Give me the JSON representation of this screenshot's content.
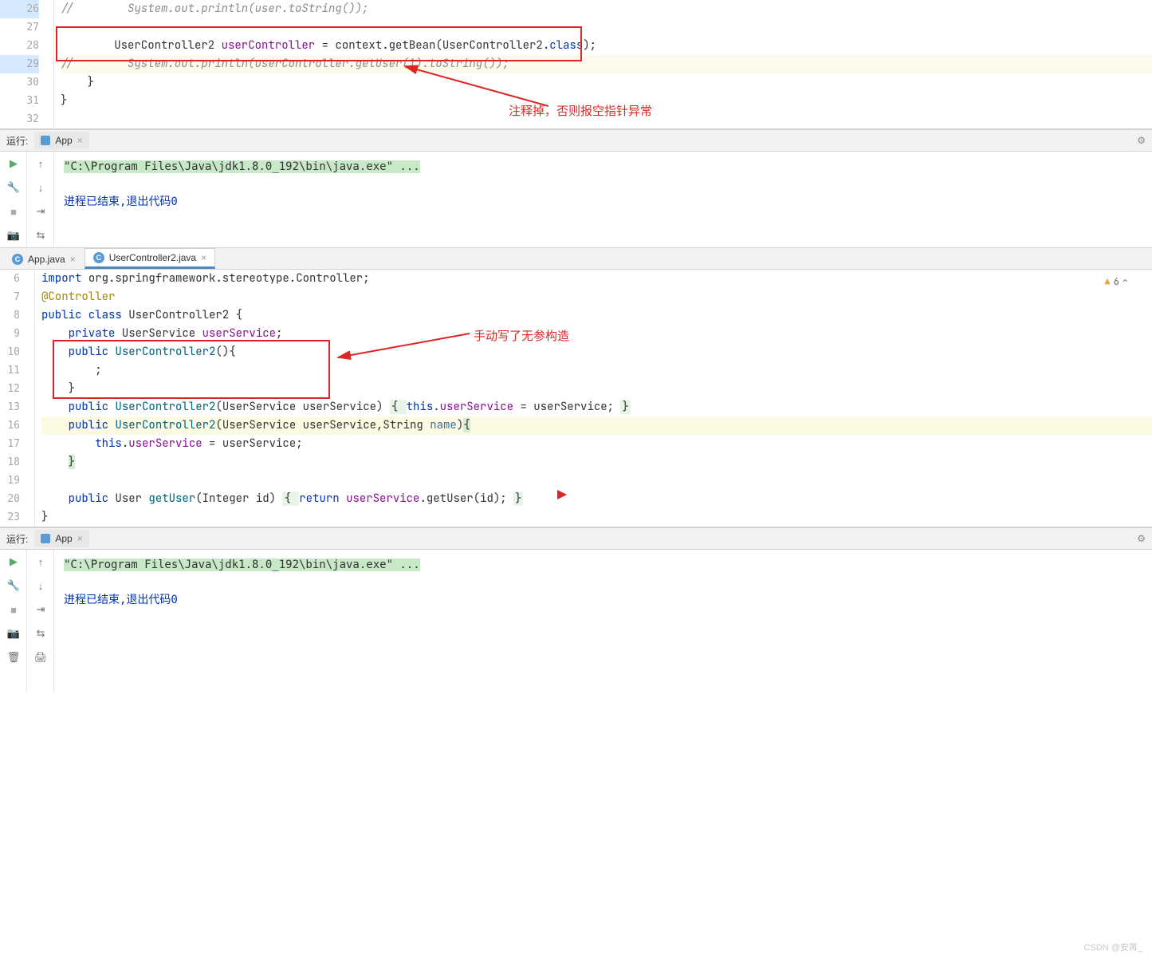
{
  "top_editor": {
    "lines": [
      {
        "n": "26",
        "cls": "changed",
        "html": "//        System.out.println(user.toString());",
        "comment": true
      },
      {
        "n": "27",
        "cls": "",
        "html": ""
      },
      {
        "n": "28",
        "cls": "",
        "tokens": [
          [
            "        UserController2 ",
            ""
          ],
          [
            "userController",
            "c-field"
          ],
          [
            " = context.getBean(UserController2.",
            ""
          ],
          [
            "class",
            "c-key"
          ],
          [
            ");",
            ""
          ]
        ]
      },
      {
        "n": "29",
        "cls": "changed",
        "hl": true,
        "tokens": [
          [
            "//        System.out.println(userController.getUser(1).toString());",
            "c-comment"
          ]
        ]
      },
      {
        "n": "30",
        "cls": "",
        "html": "    }"
      },
      {
        "n": "31",
        "cls": "",
        "html": "}"
      },
      {
        "n": "32",
        "cls": "",
        "html": ""
      }
    ],
    "annotation": "注释掉，否则报空指针异常"
  },
  "run_panels": {
    "label": "运行:",
    "app_tab": "App",
    "output_cmd": "\"C:\\Program Files\\Java\\jdk1.8.0_192\\bin\\java.exe\" ...",
    "output_exit": "进程已结束,退出代码0"
  },
  "file_tabs": [
    {
      "name": "App.java",
      "active": false
    },
    {
      "name": "UserController2.java",
      "active": true
    }
  ],
  "second_editor": {
    "warn_count": "6",
    "annotation": "手动写了无参构造",
    "lines": [
      {
        "n": "6",
        "tokens": [
          [
            "import ",
            "c-key"
          ],
          [
            "org.springframework.stereotype.Controller;",
            ""
          ]
        ]
      },
      {
        "n": "7",
        "tokens": [
          [
            "@Controller",
            "c-anno"
          ]
        ]
      },
      {
        "n": "8",
        "tokens": [
          [
            "public class ",
            "c-key"
          ],
          [
            "UserController2 {",
            ""
          ]
        ]
      },
      {
        "n": "9",
        "tokens": [
          [
            "    ",
            ""
          ],
          [
            "private ",
            "c-key"
          ],
          [
            "UserService ",
            ""
          ],
          [
            "userService",
            "c-field"
          ],
          [
            ";",
            ""
          ]
        ]
      },
      {
        "n": "10",
        "tokens": [
          [
            "    ",
            ""
          ],
          [
            "public ",
            "c-key"
          ],
          [
            "UserController2",
            "c-method"
          ],
          [
            "(){",
            ""
          ]
        ]
      },
      {
        "n": "11",
        "tokens": [
          [
            "        ;",
            ""
          ]
        ]
      },
      {
        "n": "12",
        "tokens": [
          [
            "    }",
            ""
          ]
        ]
      },
      {
        "n": "13",
        "tokens": [
          [
            "    ",
            ""
          ],
          [
            "public ",
            "c-key"
          ],
          [
            "UserController2",
            "c-method"
          ],
          [
            "(UserService userService) ",
            ""
          ],
          [
            "{ ",
            "seg"
          ],
          [
            "this",
            "c-key"
          ],
          [
            ".",
            ""
          ],
          [
            "userService",
            "c-field"
          ],
          [
            " = userService; ",
            ""
          ],
          [
            "}",
            "seg"
          ]
        ]
      },
      {
        "n": "16",
        "hl": true,
        "tokens": [
          [
            "    ",
            ""
          ],
          [
            "public ",
            "c-key"
          ],
          [
            "UserController2",
            "c-method"
          ],
          [
            "(UserService userService,String ",
            ""
          ],
          [
            "name",
            "c-param"
          ],
          [
            ")",
            ""
          ],
          [
            "{",
            "brace"
          ]
        ]
      },
      {
        "n": "17",
        "tokens": [
          [
            "        ",
            ""
          ],
          [
            "this",
            "c-key"
          ],
          [
            ".",
            ""
          ],
          [
            "userService",
            "c-field"
          ],
          [
            " = userService;",
            ""
          ]
        ]
      },
      {
        "n": "18",
        "tokens": [
          [
            "    ",
            ""
          ],
          [
            "}",
            "brace"
          ]
        ]
      },
      {
        "n": "19",
        "tokens": [
          [
            "",
            ""
          ]
        ]
      },
      {
        "n": "20",
        "tokens": [
          [
            "    ",
            ""
          ],
          [
            "public ",
            "c-key"
          ],
          [
            "User ",
            ""
          ],
          [
            "getUser",
            "c-method"
          ],
          [
            "(Integer id) ",
            ""
          ],
          [
            "{ ",
            "seg"
          ],
          [
            "return ",
            "c-key"
          ],
          [
            "userService",
            "c-field"
          ],
          [
            ".getUser(id); ",
            ""
          ],
          [
            "}",
            "seg"
          ]
        ]
      },
      {
        "n": "23",
        "tokens": [
          [
            "}",
            ""
          ]
        ]
      }
    ]
  },
  "watermark": "CSDN @安苒_"
}
